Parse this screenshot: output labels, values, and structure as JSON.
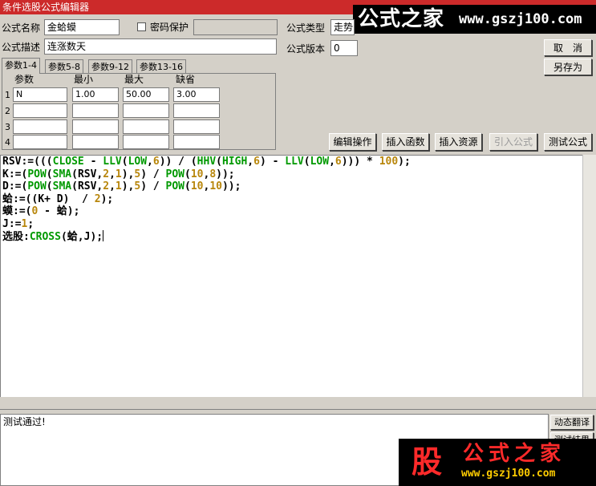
{
  "window": {
    "title": "条件选股公式编辑器"
  },
  "watermark": {
    "top_text": "公式之家",
    "top_url": "www.gszj100.com",
    "bottom_badge": "股",
    "bottom_text": "公式之家",
    "bottom_url": "www.gszj100.com"
  },
  "form": {
    "name_label": "公式名称",
    "name_value": "金蛤蟆",
    "password_label": "密码保护",
    "password_value": "",
    "desc_label": "公式描述",
    "desc_value": "连涨数天",
    "type_label": "公式类型",
    "type_value": "走势",
    "version_label": "公式版本",
    "version_value": "0"
  },
  "buttons": {
    "cancel": "取　消",
    "save_as": "另存为",
    "edit_ops": "编辑操作",
    "insert_func": "插入函数",
    "insert_res": "插入资源",
    "import_formula": "引入公式",
    "test_formula": "测试公式",
    "dynamic_translate": "动态翻译",
    "test_result": "测试结果"
  },
  "tabs": [
    "参数1-4",
    "参数5-8",
    "参数9-12",
    "参数13-16"
  ],
  "params": {
    "headers": [
      "参数",
      "最小",
      "最大",
      "缺省"
    ],
    "rows": [
      {
        "num": "1",
        "name": "N",
        "min": "1.00",
        "max": "50.00",
        "default": "3.00"
      },
      {
        "num": "2",
        "name": "",
        "min": "",
        "max": "",
        "default": ""
      },
      {
        "num": "3",
        "name": "",
        "min": "",
        "max": "",
        "default": ""
      },
      {
        "num": "4",
        "name": "",
        "min": "",
        "max": "",
        "default": ""
      }
    ]
  },
  "code": [
    "RSV:=(((CLOSE - LLV(LOW,6)) / (HHV(HIGH,6) - LLV(LOW,6))) * 100);",
    "K:=(POW(SMA(RSV,2,1),5) / POW(10,8));",
    "D:=(POW(SMA(RSV,2,1),5) / POW(10,10));",
    "蛤:=((K+ D)  / 2);",
    "蟆:=(0 - 蛤);",
    "J:=1;",
    "选股:CROSS(蛤,J);"
  ],
  "status": {
    "result_text": "测试通过!"
  }
}
